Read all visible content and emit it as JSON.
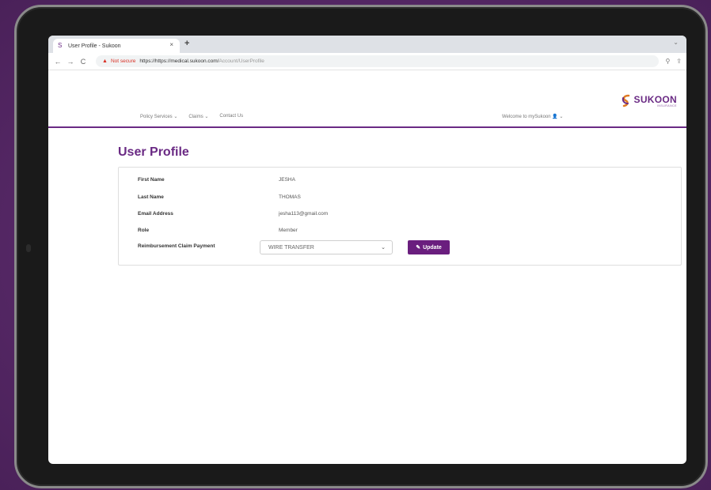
{
  "browser": {
    "tab_title": "User Profile - Sukoon",
    "tab_close": "×",
    "new_tab": "+",
    "window_control": "⌄",
    "not_secure": "Not secure",
    "url_host": "https://https://medical.sukoon.com/",
    "url_path": "Account/UserProfile"
  },
  "site": {
    "logo_text": "SUKOON",
    "logo_sub": "INSURANCE",
    "nav": [
      {
        "label": "Policy Services ⌄"
      },
      {
        "label": "Claims ⌄"
      },
      {
        "label": "Contact Us"
      }
    ],
    "welcome": "Welcome to mySukoon 👤 ⌄"
  },
  "page": {
    "title": "User Profile",
    "fields": [
      {
        "label": "First Name",
        "value": "JESHA"
      },
      {
        "label": "Last Name",
        "value": "THOMAS"
      },
      {
        "label": "Email Address",
        "value": "jesha113@gmail.com"
      },
      {
        "label": "Role",
        "value": "Member"
      },
      {
        "label": "Reimbursement Claim Payment",
        "value": ""
      }
    ],
    "payment_select": "WIRE TRANSFER",
    "update_label": "Update"
  },
  "colors": {
    "brand": "#6a2a84",
    "button": "#6a1e7e",
    "background": "#5a2a6e"
  }
}
